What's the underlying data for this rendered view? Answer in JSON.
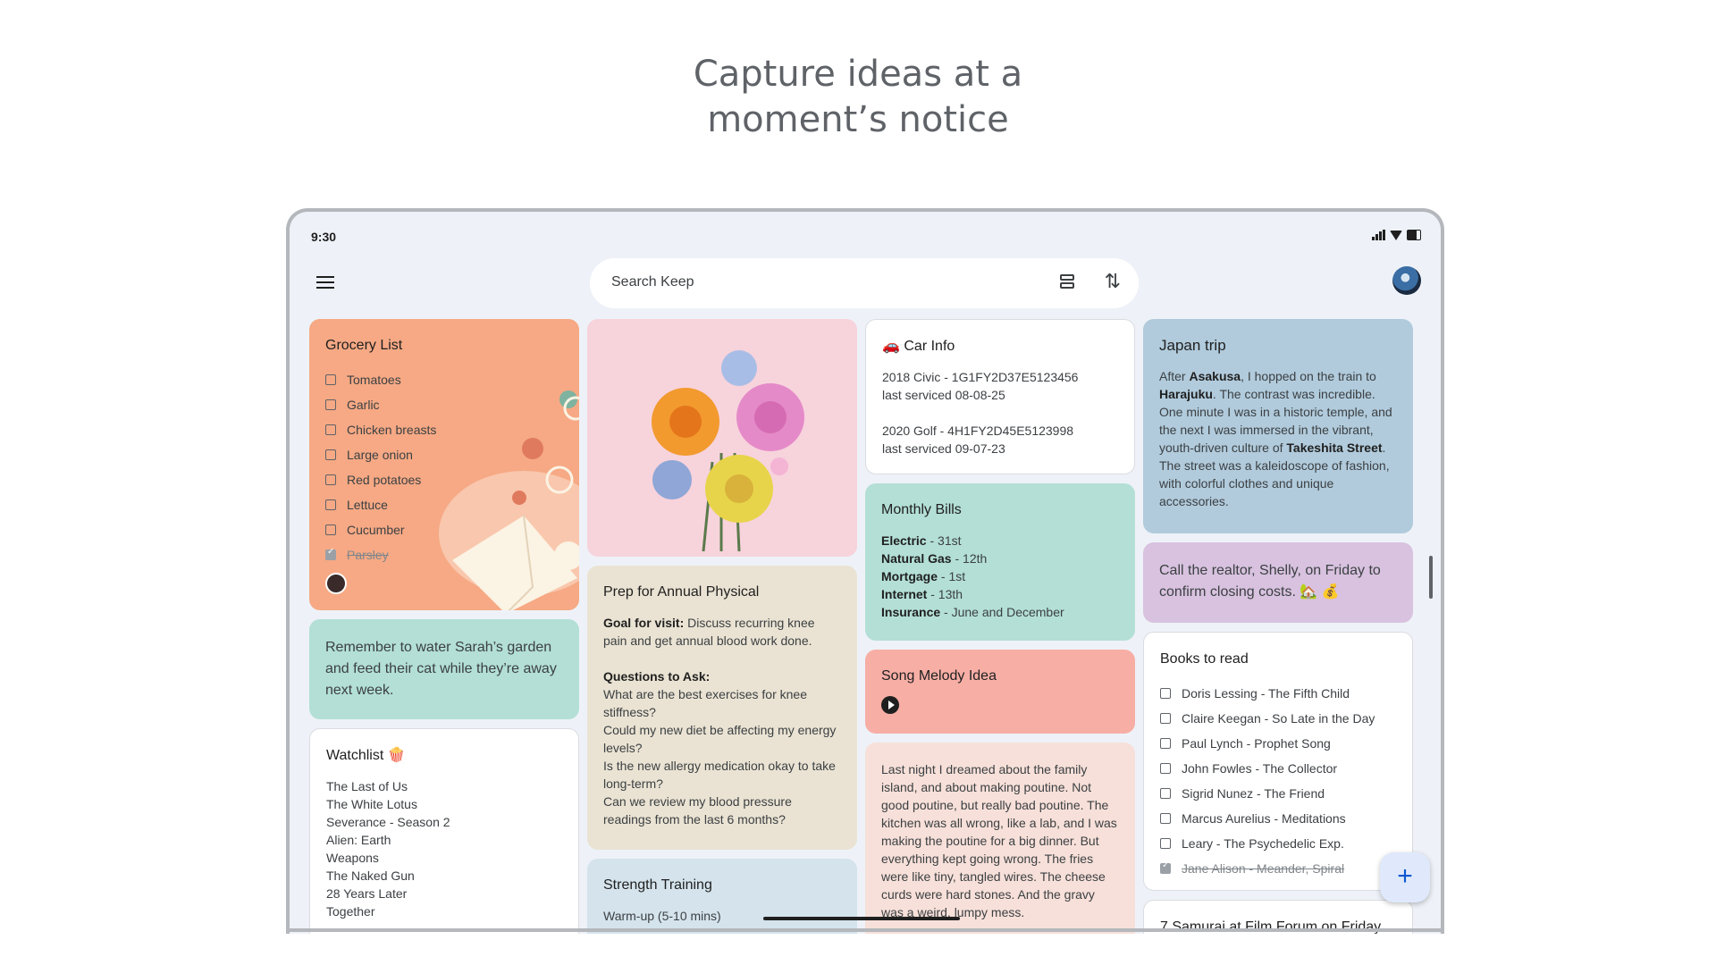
{
  "headline": {
    "line1": "Capture ideas at a",
    "line2": "moment’s notice"
  },
  "status": {
    "time": "9:30"
  },
  "search": {
    "placeholder": "Search Keep"
  },
  "icons": {
    "menu": "menu-icon",
    "layout": "list-view-icon",
    "sort": "sort-icon",
    "add": "plus-icon",
    "play": "play-icon"
  },
  "grocery": {
    "title": "Grocery List",
    "items": [
      {
        "label": "Tomatoes",
        "checked": false
      },
      {
        "label": "Garlic",
        "checked": false
      },
      {
        "label": "Chicken breasts",
        "checked": false
      },
      {
        "label": "Large onion",
        "checked": false
      },
      {
        "label": "Red potatoes",
        "checked": false
      },
      {
        "label": "Lettuce",
        "checked": false
      },
      {
        "label": "Cucumber",
        "checked": false
      },
      {
        "label": "Parsley",
        "checked": true
      }
    ]
  },
  "reminder": {
    "text": "Remember to water Sarah’s garden and feed their cat while they’re away next week."
  },
  "watchlist": {
    "title": "Watchlist 🍿",
    "items": [
      "The Last of Us",
      "The White Lotus",
      "Severance - Season 2",
      "Alien: Earth",
      "Weapons",
      "The Naked Gun",
      "28 Years Later",
      "Together"
    ]
  },
  "physical": {
    "title": "Prep for Annual Physical",
    "goal_label": "Goal for visit:",
    "goal_text": "Discuss recurring knee pain and get annual blood work done.",
    "questions_label": "Questions to Ask:",
    "questions": [
      "What are the best exercises for knee stiffness?",
      "Could my new diet be affecting my energy levels?",
      "Is the new allergy medication okay to take long-term?",
      "Can we review my blood pressure readings from the last 6 months?"
    ]
  },
  "strength": {
    "title": "Strength Training",
    "line1": "Warm-up (5-10 mins)"
  },
  "car": {
    "title": "🚗 Car Info",
    "car1_line1": "2018 Civic - 1G1FY2D37E5123456",
    "car1_line2": "last serviced 08-08-25",
    "car2_line1": "2020 Golf - 4H1FY2D45E5123998",
    "car2_line2": "last serviced 09-07-23"
  },
  "bills": {
    "title": "Monthly Bills",
    "items": [
      {
        "label": "Electric",
        "value": " - 31st"
      },
      {
        "label": "Natural Gas",
        "value": " - 12th"
      },
      {
        "label": "Mortgage",
        "value": " - 1st"
      },
      {
        "label": "Internet",
        "value": " - 13th"
      },
      {
        "label": "Insurance",
        "value": " - June and December"
      }
    ]
  },
  "song": {
    "title": "Song Melody Idea"
  },
  "dream": {
    "text": "Last night I dreamed about the family island, and about making poutine. Not good poutine, but really bad poutine. The kitchen was all wrong, like a lab, and I was making the poutine for a big dinner. But everything kept going wrong. The fries were like tiny, tangled wires. The cheese curds were hard stones. And the gravy was a weird, lumpy mess."
  },
  "japan": {
    "title": "Japan trip",
    "p1": "After ",
    "b1": "Asakusa",
    "p2": ", I hopped on the train to ",
    "b2": "Harajuku",
    "p3": ". The contrast was incredible. One minute I was in a historic temple, and the next I was immersed in the vibrant, youth-driven culture of ",
    "b3": "Takeshita Street",
    "p4": ". The street was a kaleidoscope of fashion, with colorful clothes and unique accessories."
  },
  "realtor": {
    "text": "Call the realtor, Shelly, on Friday to confirm closing costs. 🏡 💰"
  },
  "books": {
    "title": "Books to read",
    "items": [
      {
        "label": "Doris Lessing - The Fifth Child",
        "checked": false
      },
      {
        "label": "Claire Keegan - So Late in the Day",
        "checked": false
      },
      {
        "label": "Paul Lynch - Prophet Song",
        "checked": false
      },
      {
        "label": "John Fowles - The Collector",
        "checked": false
      },
      {
        "label": "Sigrid Nunez - The Friend",
        "checked": false
      },
      {
        "label": "Marcus Aurelius - Meditations",
        "checked": false
      },
      {
        "label": "Leary - The Psychedelic Exp.",
        "checked": false
      },
      {
        "label": "Jane Alison - Meander, Spiral",
        "checked": true
      }
    ]
  },
  "samurai": {
    "title": "7 Samurai at Film Forum on Friday"
  },
  "colors": {
    "grocery": "#f6a984",
    "reminder": "#b3dfd6",
    "flowers": "#f7d3dc",
    "physical": "#eae3d3",
    "strength": "#d4e3ec",
    "bills": "#b3dfd6",
    "song": "#f7aea5",
    "dream": "#f7e0d9",
    "japan": "#b1cbdc",
    "realtor": "#d8c2df"
  }
}
